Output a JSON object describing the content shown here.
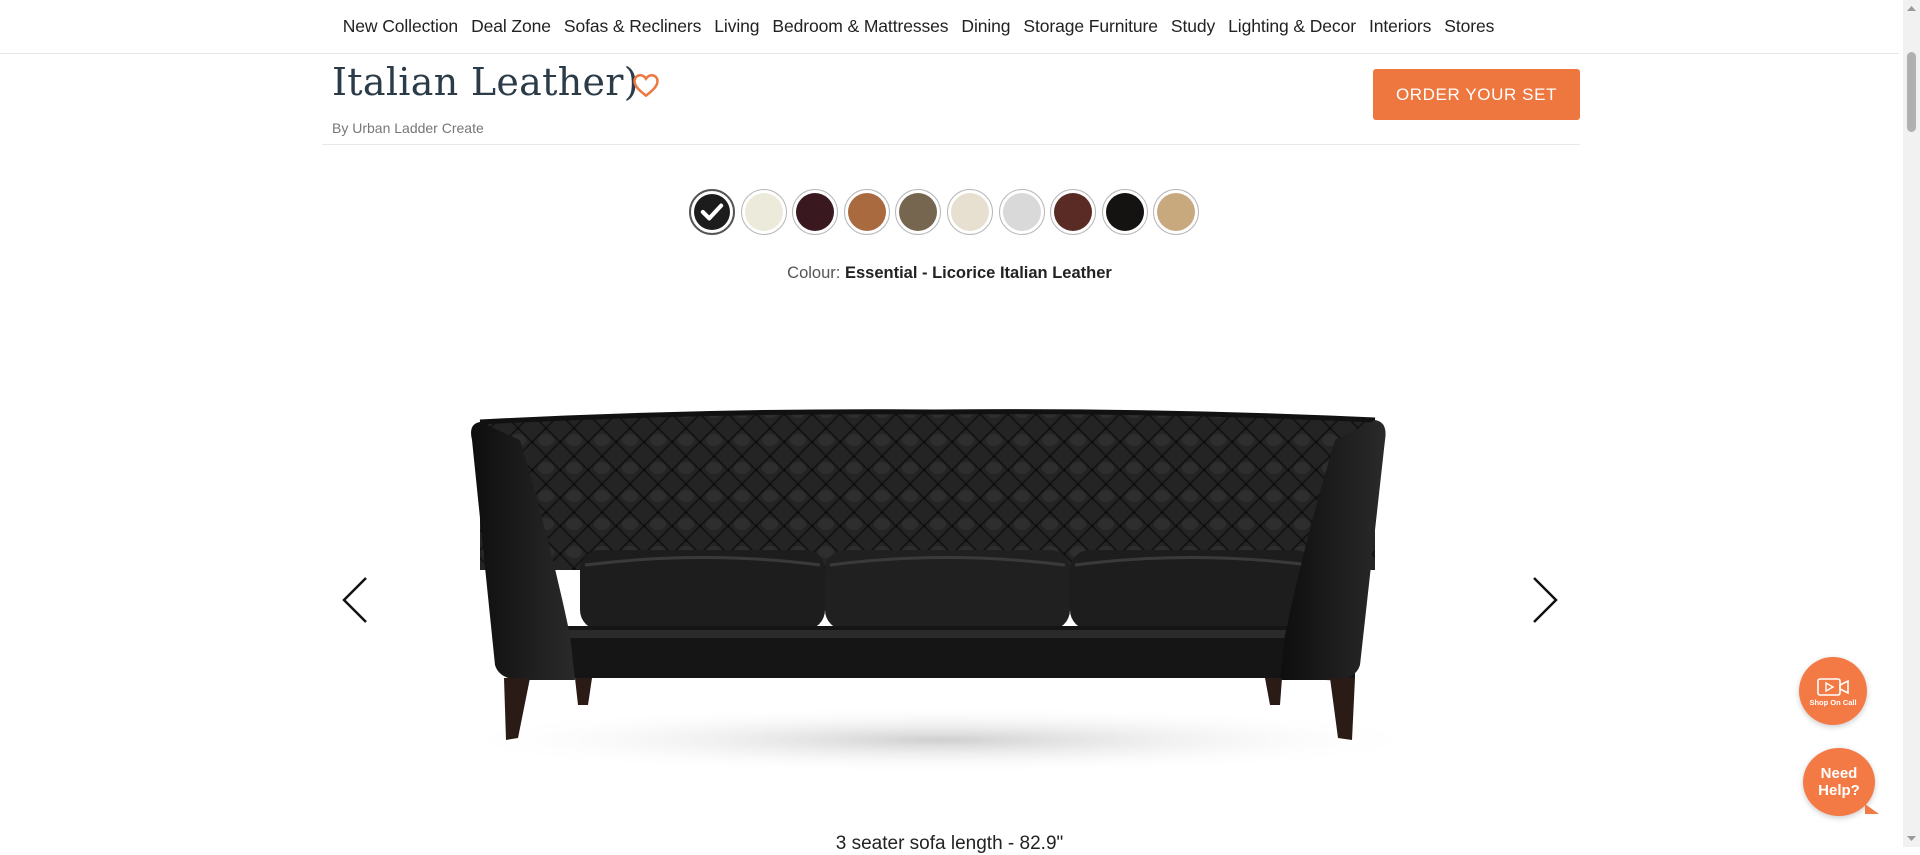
{
  "nav": {
    "items": [
      "New Collection",
      "Deal Zone",
      "Sofas & Recliners",
      "Living",
      "Bedroom & Mattresses",
      "Dining",
      "Storage Furniture",
      "Study",
      "Lighting & Decor",
      "Interiors",
      "Stores"
    ]
  },
  "product": {
    "title": "Italian Leather)",
    "byline_prefix": "By",
    "brand": "Urban Ladder Create",
    "order_button": "ORDER YOUR SET"
  },
  "colours": {
    "label": "Colour:",
    "selected_name": "Essential - Licorice Italian Leather",
    "swatches": [
      "#1c1c1c",
      "#ecebdb",
      "#3a1820",
      "#a86a3e",
      "#76664f",
      "#e7dfd0",
      "#d9d9d9",
      "#5a2a24",
      "#141312",
      "#c8a97e"
    ],
    "selected_index": 0
  },
  "image": {
    "alt_icon": "sofa-image"
  },
  "dimension_text": "3 seater sofa length - 82.9\"",
  "floating": {
    "call_label": "Shop On Call",
    "help_label": "Need Help?"
  },
  "accent_color": "#ee7740"
}
